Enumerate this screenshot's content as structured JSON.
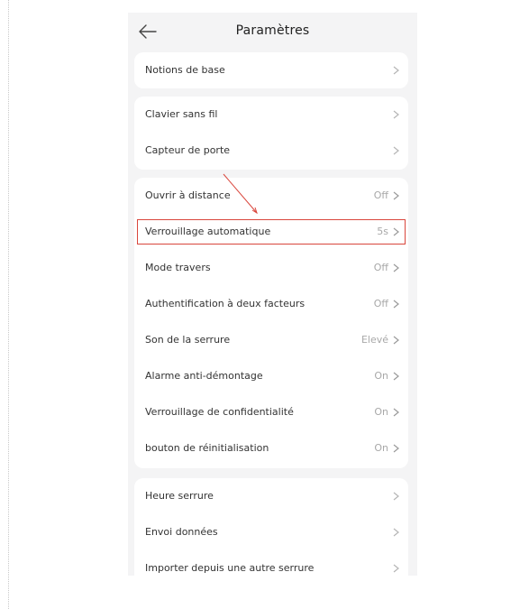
{
  "header": {
    "title": "Paramètres"
  },
  "groups": [
    {
      "items": [
        {
          "label": "Notions de base",
          "value": ""
        }
      ]
    },
    {
      "items": [
        {
          "label": "Clavier sans fil",
          "value": ""
        },
        {
          "label": "Capteur de porte",
          "value": ""
        }
      ]
    },
    {
      "items": [
        {
          "label": "Ouvrir à distance",
          "value": "Off"
        },
        {
          "label": "Verrouillage automatique",
          "value": "5s"
        },
        {
          "label": "Mode travers",
          "value": "Off"
        },
        {
          "label": "Authentification à deux facteurs",
          "value": "Off"
        },
        {
          "label": "Son de la serrure",
          "value": "Elevé"
        },
        {
          "label": "Alarme anti-démontage",
          "value": "On"
        },
        {
          "label": "Verrouillage de confidentialité",
          "value": "On"
        },
        {
          "label": "bouton de réinitialisation",
          "value": "On"
        }
      ]
    },
    {
      "items": [
        {
          "label": "Heure serrure",
          "value": ""
        },
        {
          "label": "Envoi données",
          "value": ""
        },
        {
          "label": "Importer depuis une autre serrure",
          "value": ""
        }
      ]
    }
  ],
  "annotation": {
    "color": "#d9463c",
    "highlighted_item": "Verrouillage automatique"
  }
}
